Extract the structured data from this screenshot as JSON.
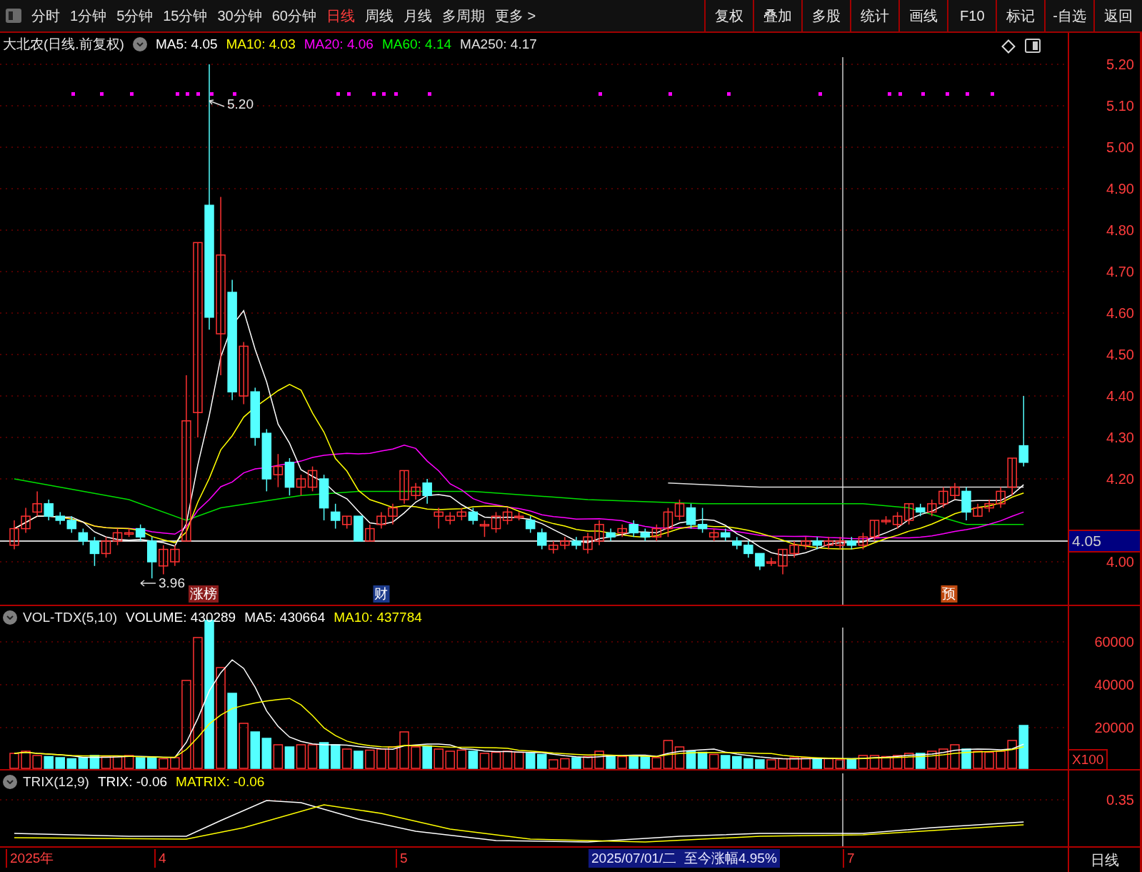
{
  "toolbar": {
    "periods": [
      {
        "label": "分时",
        "selected": false
      },
      {
        "label": "1分钟",
        "selected": false
      },
      {
        "label": "5分钟",
        "selected": false
      },
      {
        "label": "15分钟",
        "selected": false
      },
      {
        "label": "30分钟",
        "selected": false
      },
      {
        "label": "60分钟",
        "selected": false
      },
      {
        "label": "日线",
        "selected": true
      },
      {
        "label": "周线",
        "selected": false
      },
      {
        "label": "月线",
        "selected": false
      },
      {
        "label": "多周期",
        "selected": false
      },
      {
        "label": "更多 >",
        "selected": false
      }
    ],
    "buttons": [
      "复权",
      "叠加",
      "多股",
      "统计",
      "画线",
      "F10",
      "标记",
      "-自选",
      "返回"
    ]
  },
  "price_panel": {
    "title": "大北农(日线.前复权)",
    "indicators": [
      {
        "label": "MA5: 4.05",
        "color": "#ffffff"
      },
      {
        "label": "MA10: 4.03",
        "color": "#ffff00"
      },
      {
        "label": "MA20: 4.06",
        "color": "#ff00ff"
      },
      {
        "label": "MA60: 4.14",
        "color": "#00ff00"
      },
      {
        "label": "MA250: 4.17",
        "color": "#e0e0e0"
      }
    ],
    "high_label": "5.20",
    "low_label": "3.96",
    "markers": [
      {
        "label": "涨榜",
        "color": "#8b1c1c"
      },
      {
        "label": "财",
        "color": "#1c3a8b"
      },
      {
        "label": "预",
        "color": "#c04a10"
      }
    ],
    "axis_ticks": [
      "5.20",
      "5.10",
      "5.00",
      "4.90",
      "4.80",
      "4.70",
      "4.60",
      "4.50",
      "4.40",
      "4.30",
      "4.20",
      "4.00"
    ],
    "current_price": "4.05"
  },
  "volume_panel": {
    "title": "VOL-TDX(5,10)",
    "indicators": [
      {
        "label": "VOLUME: 430289",
        "color": "#ffffff"
      },
      {
        "label": "MA5: 430664",
        "color": "#ffffff"
      },
      {
        "label": "MA10: 437784",
        "color": "#ffff00"
      }
    ],
    "axis_ticks": [
      "60000",
      "40000",
      "20000"
    ],
    "unit": "X100"
  },
  "trix_panel": {
    "title": "TRIX(12,9)",
    "indicators": [
      {
        "label": "TRIX: -0.06",
        "color": "#ffffff"
      },
      {
        "label": "MATRIX: -0.06",
        "color": "#ffff00"
      }
    ],
    "axis_ticks": [
      "0.35"
    ]
  },
  "time_axis": {
    "labels": [
      "2025年",
      "4",
      "5",
      "7"
    ],
    "cursor_info": "2025/07/01/二  至今涨幅4.95%",
    "period": "日线"
  }
}
